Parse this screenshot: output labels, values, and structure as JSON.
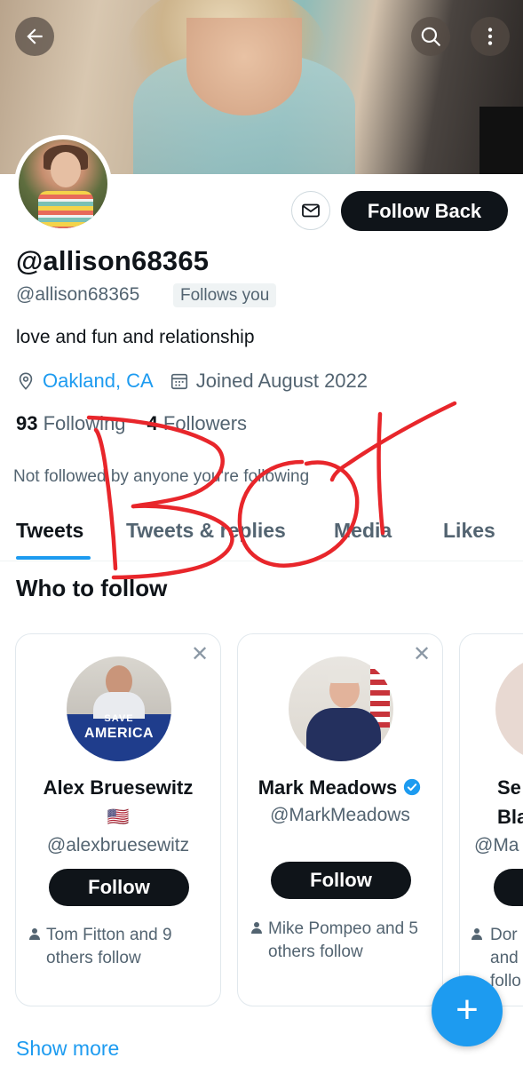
{
  "header": {
    "back_icon": "arrow-left-icon",
    "search_icon": "search-icon",
    "more_icon": "more-vertical-icon"
  },
  "profile": {
    "display_name": "@allison68365",
    "handle": "@allison68365",
    "follows_you_badge": "Follows you",
    "bio": "love and fun and relationship",
    "location": "Oakland, CA",
    "joined": "Joined August 2022",
    "following_count": "93",
    "following_label": "Following",
    "followers_count": "4",
    "followers_label": "Followers",
    "not_followed_text": "Not followed by anyone you're following",
    "follow_back_label": "Follow Back",
    "message_icon": "envelope-icon"
  },
  "tabs": [
    {
      "label": "Tweets",
      "active": true
    },
    {
      "label": "Tweets & replies",
      "active": false
    },
    {
      "label": "Media",
      "active": false
    },
    {
      "label": "Likes",
      "active": false
    }
  ],
  "who_to_follow": {
    "title": "Who to follow",
    "cards": [
      {
        "name": "Alex Bruesewitz",
        "flag": "🇺🇸",
        "handle": "@alexbruesewitz",
        "follow_label": "Follow",
        "social_context": "Tom Fitton and 9 others follow",
        "photo_text_top": "SAVE",
        "photo_text_main": "AMERICA"
      },
      {
        "name": "Mark Meadows",
        "verified": true,
        "handle": "@MarkMeadows",
        "follow_label": "Follow",
        "social_context": "Mike Pompeo and 5 others follow"
      },
      {
        "name_partial_1": "Se",
        "name_partial_2": "Bla",
        "handle_partial": "@Ma",
        "social_partial_1": "Dor",
        "social_partial_2": "and",
        "social_partial_3": "follo"
      }
    ],
    "show_more": "Show more"
  },
  "fab": {
    "label": "+"
  },
  "annotation": {
    "text": "Bot",
    "color": "#e8262b"
  },
  "colors": {
    "accent": "#1d9bf0",
    "text": "#0f1419",
    "muted": "#536471"
  }
}
